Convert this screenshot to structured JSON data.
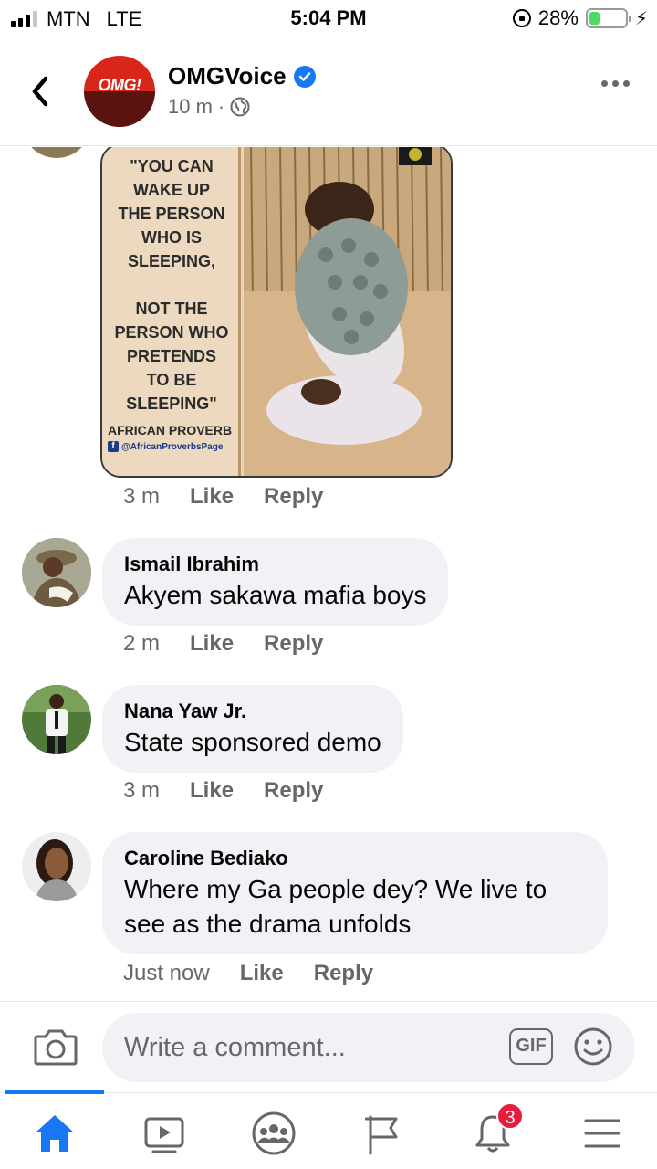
{
  "status_bar": {
    "carrier": "MTN",
    "network": "LTE",
    "time": "5:04 PM",
    "battery_percent": "28%",
    "battery_level": 0.28
  },
  "header": {
    "page_name": "OMGVoice",
    "avatar_logo_text": "OMG!",
    "post_age": "10 m",
    "meta_separator": "·",
    "icons": [
      "back-chevron-icon",
      "verified-badge-icon",
      "globe-icon",
      "more-dots-icon"
    ]
  },
  "meme": {
    "quote": "\"YOU CAN\nWAKE UP\nTHE PERSON\nWHO IS\nSLEEPING,\n\nNOT THE\nPERSON WHO\nPRETENDS\nTO BE\nSLEEPING\"",
    "source": "AFRICAN PROVERB",
    "handle": "@AfricanProverbsPage",
    "fb_letter": "f"
  },
  "meme_actions": {
    "time": "3 m",
    "like": "Like",
    "reply": "Reply"
  },
  "comments": [
    {
      "author": "Ismail Ibrahim",
      "text": "Akyem sakawa mafia boys",
      "time": "2 m",
      "like": "Like",
      "reply": "Reply"
    },
    {
      "author": "Nana Yaw Jr.",
      "text": "State sponsored demo",
      "time": "3 m",
      "like": "Like",
      "reply": "Reply"
    },
    {
      "author": "Caroline Bediako",
      "text": "Where my Ga people dey? We live to see as the drama unfolds",
      "time": "Just now",
      "like": "Like",
      "reply": "Reply"
    }
  ],
  "composer": {
    "placeholder": "Write a comment...",
    "gif_label": "GIF"
  },
  "tabbar": {
    "tabs": [
      "home-icon",
      "watch-icon",
      "groups-icon",
      "pages-flag-icon",
      "notifications-bell-icon",
      "menu-icon"
    ],
    "notifications_badge": "3"
  },
  "colors": {
    "accent": "#1877f2",
    "bubble": "#f0f2f5",
    "secondary_text": "#65676b",
    "badge": "#e41e3f",
    "battery": "#4cd964"
  }
}
